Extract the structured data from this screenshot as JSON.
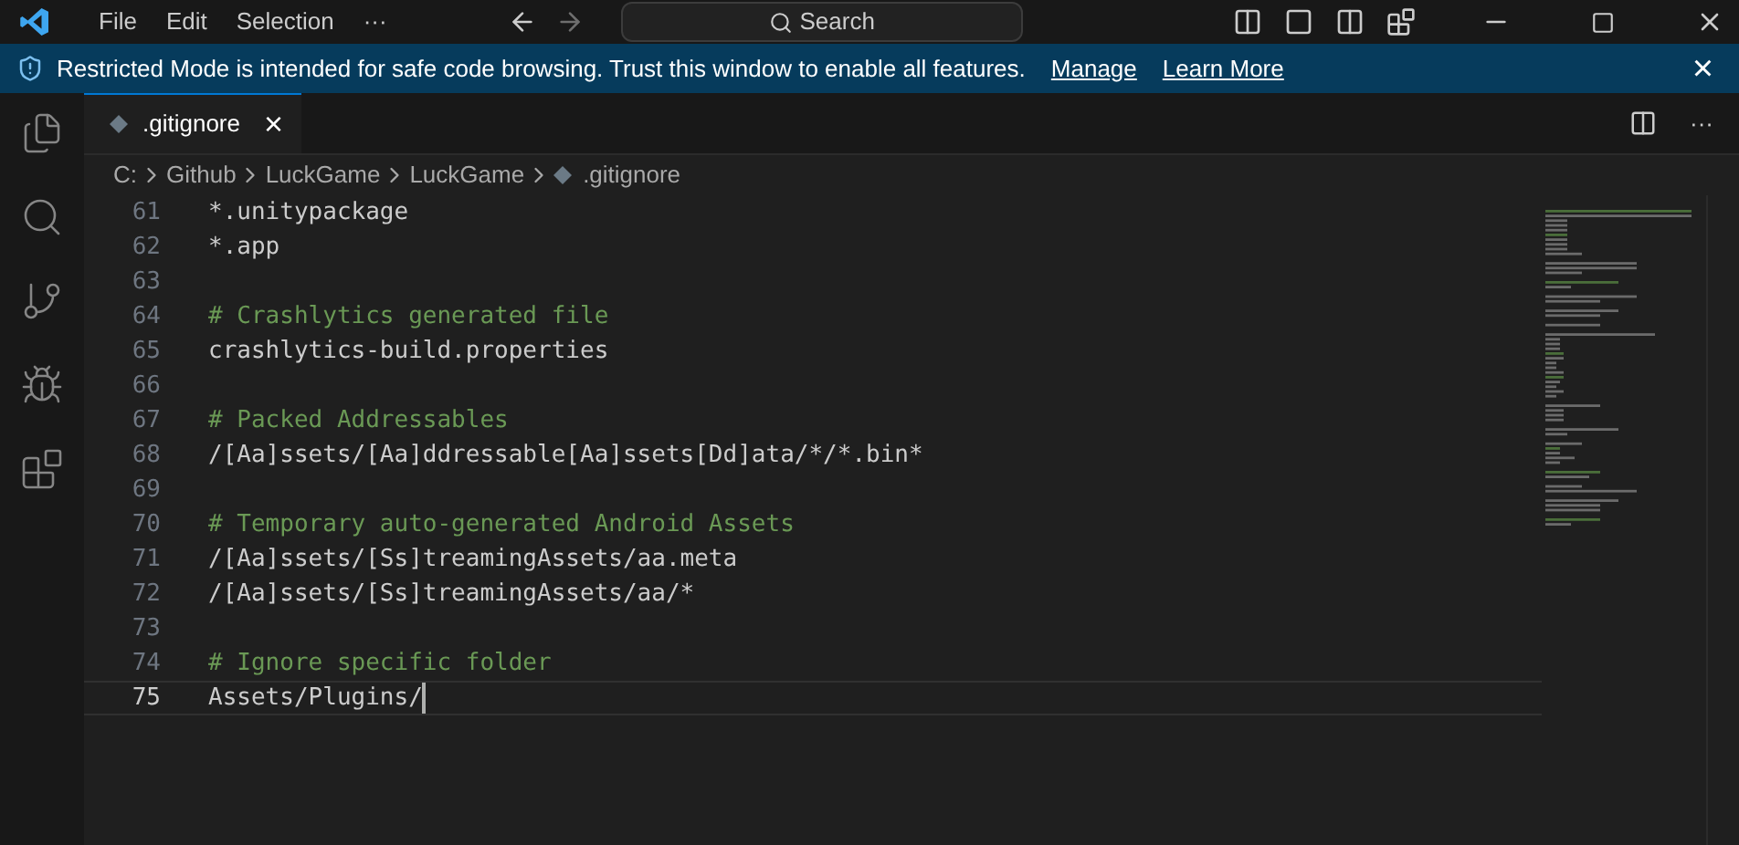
{
  "menu": [
    "File",
    "Edit",
    "Selection",
    "···"
  ],
  "search": {
    "placeholder": "Search"
  },
  "banner": {
    "message": "Restricted Mode is intended for safe code browsing. Trust this window to enable all features.",
    "links": [
      "Manage",
      "Learn More"
    ],
    "close": "×"
  },
  "activity_bar": [
    {
      "kind": "explorer",
      "selected": false
    },
    {
      "kind": "search",
      "selected": false
    },
    {
      "kind": "scm",
      "selected": false
    },
    {
      "kind": "debug",
      "selected": false
    },
    {
      "kind": "extensions",
      "selected": false
    }
  ],
  "tabs": [
    {
      "label": ".gitignore",
      "selected": true,
      "close": "×"
    }
  ],
  "editor_actions": {
    "more": "···"
  },
  "breadcrumb": [
    "C:",
    "Github",
    "LuckGame",
    "LuckGame",
    ".gitignore"
  ],
  "lines": [
    {
      "number": "61",
      "kind": "code",
      "text": "*.unitypackage",
      "current": false
    },
    {
      "number": "62",
      "kind": "code",
      "text": "*.app",
      "current": false
    },
    {
      "number": "63",
      "kind": "blank",
      "current": false
    },
    {
      "number": "64",
      "kind": "comment",
      "text": "# Crashlytics generated file",
      "current": false
    },
    {
      "number": "65",
      "kind": "code",
      "text": "crashlytics-build.properties",
      "current": false
    },
    {
      "number": "66",
      "kind": "blank",
      "current": false
    },
    {
      "number": "67",
      "kind": "comment",
      "text": "# Packed Addressables",
      "current": false
    },
    {
      "number": "68",
      "kind": "code",
      "text": "/[Aa]ssets/[Aa]ddressable[Aa]ssets[Dd]ata/*/*.bin*",
      "current": false
    },
    {
      "number": "69",
      "kind": "blank",
      "current": false
    },
    {
      "number": "70",
      "kind": "comment",
      "text": "# Temporary auto-generated Android Assets",
      "current": false
    },
    {
      "number": "71",
      "kind": "code",
      "text": "/[Aa]ssets/[Ss]treamingAssets/aa.meta",
      "current": false
    },
    {
      "number": "72",
      "kind": "code",
      "text": "/[Aa]ssets/[Ss]treamingAssets/aa/*",
      "current": false
    },
    {
      "number": "73",
      "kind": "blank",
      "current": false
    },
    {
      "number": "74",
      "kind": "comment",
      "text": "# Ignore specific folder",
      "current": false
    },
    {
      "number": "75",
      "kind": "code",
      "text": "Assets/Plugins/",
      "current": true
    }
  ]
}
